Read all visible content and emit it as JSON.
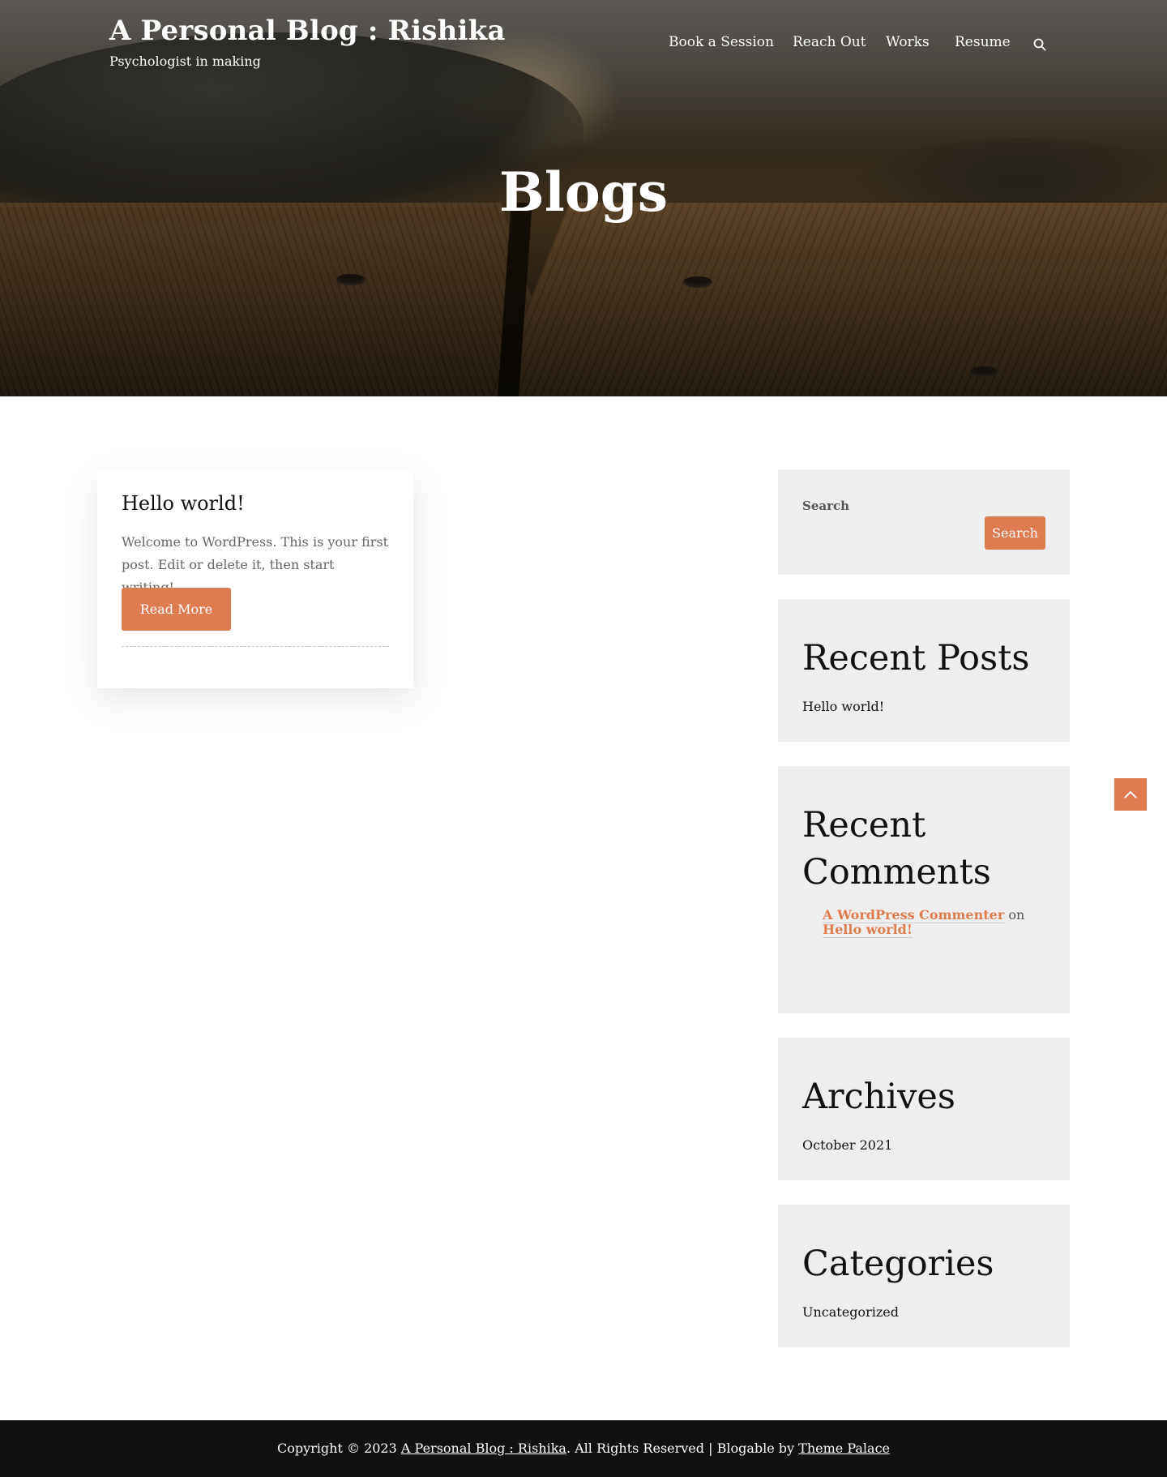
{
  "header": {
    "site_title": "A Personal Blog : Rishika",
    "tagline": "Psychologist in making",
    "nav": [
      {
        "label": "Book a Session"
      },
      {
        "label": "Reach Out"
      },
      {
        "label": "Works"
      },
      {
        "label": "Resume"
      }
    ],
    "search_icon": "search-icon"
  },
  "hero": {
    "title": "Blogs"
  },
  "posts": [
    {
      "title": "Hello world!",
      "excerpt": "Welcome to WordPress. This is your first post. Edit or delete it, then start writing!",
      "read_more": "Read More"
    }
  ],
  "sidebar": {
    "search": {
      "label": "Search",
      "button": "Search",
      "placeholder": ""
    },
    "recent_posts": {
      "title": "Recent Posts",
      "items": [
        "Hello world!"
      ]
    },
    "recent_comments": {
      "title": "Recent Comments",
      "author": "A WordPress Commenter",
      "on": "on",
      "post": "Hello world!"
    },
    "archives": {
      "title": "Archives",
      "items": [
        "October 2021"
      ]
    },
    "categories": {
      "title": "Categories",
      "items": [
        "Uncategorized"
      ]
    }
  },
  "back_to_top_icon": "chevron-up-icon",
  "footer": {
    "prefix": "Copyright © 2023",
    "site_link": "A Personal Blog : Rishika",
    "middle": ". All Rights Reserved | Blogable by",
    "theme_link": "Theme Palace"
  },
  "colors": {
    "accent": "#de7c50",
    "widget_bg": "#eeeeee",
    "footer_bg": "#111111"
  }
}
